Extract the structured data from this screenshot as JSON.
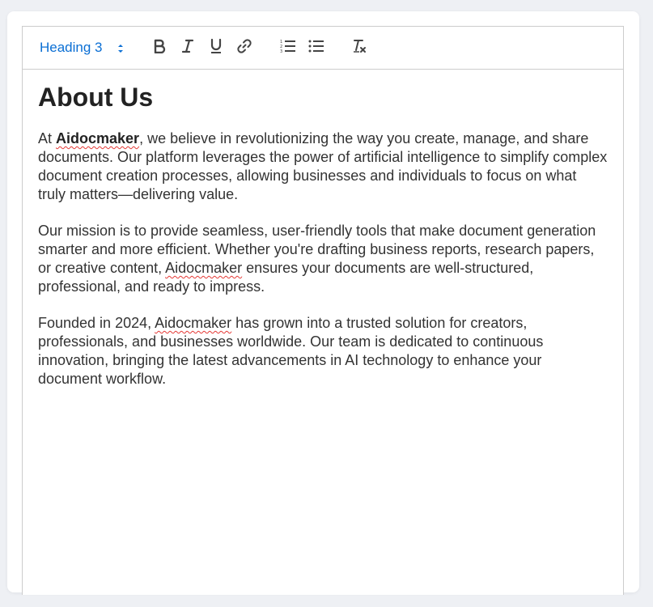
{
  "toolbar": {
    "heading_label": "Heading 3",
    "buttons": [
      "bold-icon",
      "italic-icon",
      "underline-icon",
      "link-icon",
      "ordered-list-icon",
      "bullet-list-icon",
      "clear-format-icon"
    ],
    "accent_color": "#0b6fd4"
  },
  "doc": {
    "title": "About Us",
    "p1": {
      "pre": "At ",
      "brand": "Aidocmaker",
      "post": ", we believe in revolutionizing the way you create, manage, and share documents. Our platform leverages the power of artificial intelligence to simplify complex document creation processes, allowing businesses and individuals to focus on what truly matters—delivering value."
    },
    "p2": {
      "pre": "Our mission is to provide seamless, user-friendly tools that make document generation smarter and more efficient. Whether you're drafting business reports, research papers, or creative content, ",
      "brand": "Aidocmaker",
      "post": " ensures your documents are well-structured, professional, and ready to impress."
    },
    "p3": {
      "pre": "Founded in 2024, ",
      "brand": "Aidocmaker",
      "post": " has grown into a trusted solution for creators, professionals, and businesses worldwide. Our team is dedicated to continuous innovation, bringing the latest advancements in AI technology to enhance your document workflow."
    }
  }
}
